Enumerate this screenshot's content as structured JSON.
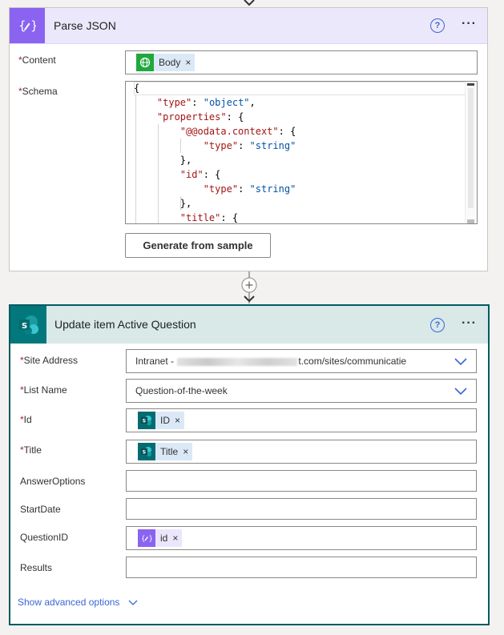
{
  "parse_json": {
    "title": "Parse JSON",
    "help_icon": "?",
    "more_icon": "···",
    "content_label": "Content",
    "schema_label": "Schema",
    "required_mark": "*",
    "content_token": {
      "label": "Body",
      "remove": "×"
    },
    "schema_lines": [
      "{",
      "    \"type\": \"object\",",
      "    \"properties\": {",
      "        \"@@odata.context\": {",
      "            \"type\": \"string\"",
      "        },",
      "        \"id\": {",
      "            \"type\": \"string\"",
      "        },",
      "        \"title\": {"
    ],
    "generate_button": "Generate from sample"
  },
  "update_item": {
    "title": "Update item Active Question",
    "help_icon": "?",
    "more_icon": "···",
    "required_mark": "*",
    "fields": {
      "site_address": {
        "label": "Site Address",
        "value_prefix": "Intranet - ",
        "value_suffix": "t.com/sites/communicatie"
      },
      "list_name": {
        "label": "List Name",
        "value": "Question-of-the-week"
      },
      "id": {
        "label": "Id",
        "token": "ID"
      },
      "title": {
        "label": "Title",
        "token": "Title"
      },
      "answer_options": {
        "label": "AnswerOptions"
      },
      "start_date": {
        "label": "StartDate"
      },
      "question_id": {
        "label": "QuestionID",
        "token": "id"
      },
      "results": {
        "label": "Results"
      }
    },
    "token_remove": "×",
    "advanced_link": "Show advanced options"
  },
  "colors": {
    "json_accent": "#8b63f1",
    "sharepoint_accent": "#03787c",
    "link": "#3b66d6",
    "required": "#a4262c"
  }
}
